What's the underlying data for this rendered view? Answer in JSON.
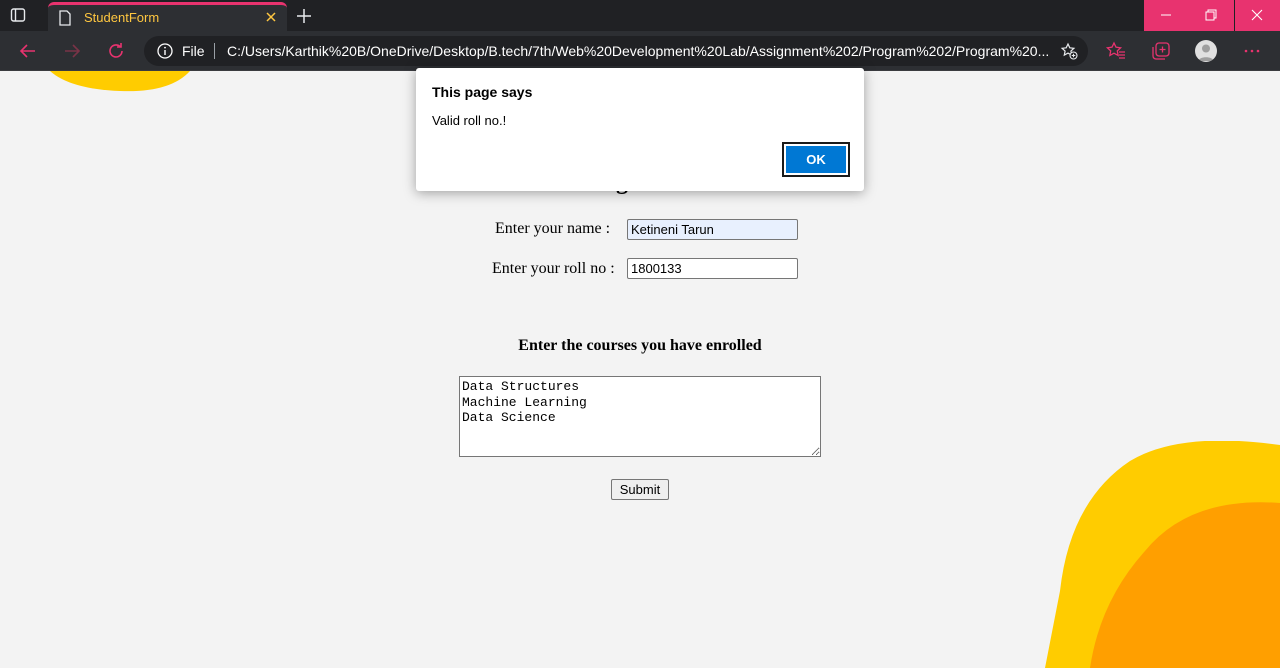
{
  "browser": {
    "tab_title": "StudentForm",
    "address_scheme_label": "File",
    "url": "C:/Users/Karthik%20B/OneDrive/Desktop/B.tech/7th/Web%20Development%20Lab/Assignment%202/Program%202/Program%20...",
    "accent_color": "#e8336f",
    "tab_title_color": "#ffc740"
  },
  "page": {
    "heading": "Student Registration Form",
    "name_label": "Enter your name :",
    "name_value": "Ketineni Tarun",
    "roll_label": "Enter your roll no :",
    "roll_value": "1800133",
    "courses_heading": "Enter the courses you have enrolled",
    "courses_value": "Data Structures\nMachine Learning\nData Science",
    "submit_label": "Submit"
  },
  "dialog": {
    "title": "This page says",
    "message": "Valid roll no.!",
    "ok_label": "OK"
  }
}
